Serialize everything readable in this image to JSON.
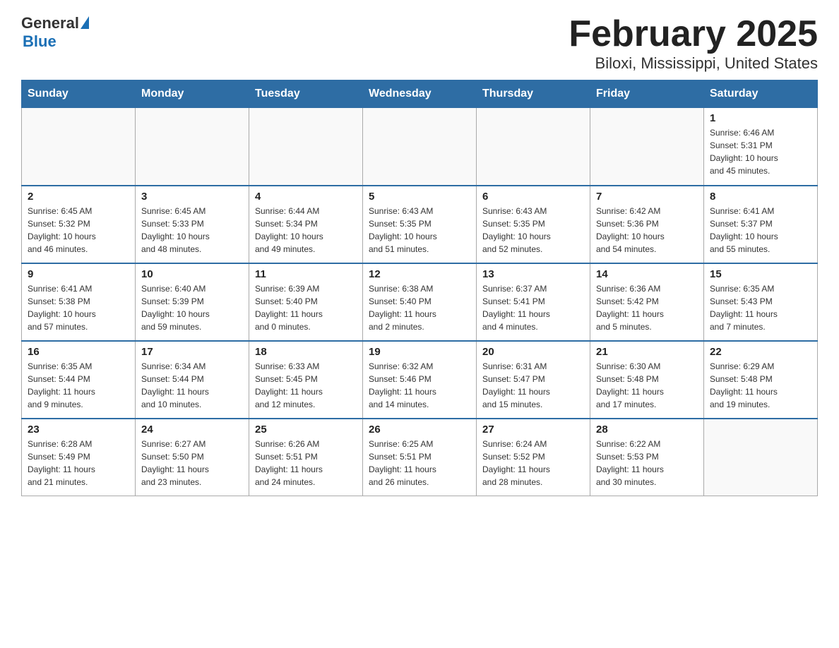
{
  "header": {
    "logo_general": "General",
    "logo_blue": "Blue",
    "title": "February 2025",
    "subtitle": "Biloxi, Mississippi, United States"
  },
  "weekdays": [
    "Sunday",
    "Monday",
    "Tuesday",
    "Wednesday",
    "Thursday",
    "Friday",
    "Saturday"
  ],
  "weeks": [
    [
      {
        "day": "",
        "info": ""
      },
      {
        "day": "",
        "info": ""
      },
      {
        "day": "",
        "info": ""
      },
      {
        "day": "",
        "info": ""
      },
      {
        "day": "",
        "info": ""
      },
      {
        "day": "",
        "info": ""
      },
      {
        "day": "1",
        "info": "Sunrise: 6:46 AM\nSunset: 5:31 PM\nDaylight: 10 hours\nand 45 minutes."
      }
    ],
    [
      {
        "day": "2",
        "info": "Sunrise: 6:45 AM\nSunset: 5:32 PM\nDaylight: 10 hours\nand 46 minutes."
      },
      {
        "day": "3",
        "info": "Sunrise: 6:45 AM\nSunset: 5:33 PM\nDaylight: 10 hours\nand 48 minutes."
      },
      {
        "day": "4",
        "info": "Sunrise: 6:44 AM\nSunset: 5:34 PM\nDaylight: 10 hours\nand 49 minutes."
      },
      {
        "day": "5",
        "info": "Sunrise: 6:43 AM\nSunset: 5:35 PM\nDaylight: 10 hours\nand 51 minutes."
      },
      {
        "day": "6",
        "info": "Sunrise: 6:43 AM\nSunset: 5:35 PM\nDaylight: 10 hours\nand 52 minutes."
      },
      {
        "day": "7",
        "info": "Sunrise: 6:42 AM\nSunset: 5:36 PM\nDaylight: 10 hours\nand 54 minutes."
      },
      {
        "day": "8",
        "info": "Sunrise: 6:41 AM\nSunset: 5:37 PM\nDaylight: 10 hours\nand 55 minutes."
      }
    ],
    [
      {
        "day": "9",
        "info": "Sunrise: 6:41 AM\nSunset: 5:38 PM\nDaylight: 10 hours\nand 57 minutes."
      },
      {
        "day": "10",
        "info": "Sunrise: 6:40 AM\nSunset: 5:39 PM\nDaylight: 10 hours\nand 59 minutes."
      },
      {
        "day": "11",
        "info": "Sunrise: 6:39 AM\nSunset: 5:40 PM\nDaylight: 11 hours\nand 0 minutes."
      },
      {
        "day": "12",
        "info": "Sunrise: 6:38 AM\nSunset: 5:40 PM\nDaylight: 11 hours\nand 2 minutes."
      },
      {
        "day": "13",
        "info": "Sunrise: 6:37 AM\nSunset: 5:41 PM\nDaylight: 11 hours\nand 4 minutes."
      },
      {
        "day": "14",
        "info": "Sunrise: 6:36 AM\nSunset: 5:42 PM\nDaylight: 11 hours\nand 5 minutes."
      },
      {
        "day": "15",
        "info": "Sunrise: 6:35 AM\nSunset: 5:43 PM\nDaylight: 11 hours\nand 7 minutes."
      }
    ],
    [
      {
        "day": "16",
        "info": "Sunrise: 6:35 AM\nSunset: 5:44 PM\nDaylight: 11 hours\nand 9 minutes."
      },
      {
        "day": "17",
        "info": "Sunrise: 6:34 AM\nSunset: 5:44 PM\nDaylight: 11 hours\nand 10 minutes."
      },
      {
        "day": "18",
        "info": "Sunrise: 6:33 AM\nSunset: 5:45 PM\nDaylight: 11 hours\nand 12 minutes."
      },
      {
        "day": "19",
        "info": "Sunrise: 6:32 AM\nSunset: 5:46 PM\nDaylight: 11 hours\nand 14 minutes."
      },
      {
        "day": "20",
        "info": "Sunrise: 6:31 AM\nSunset: 5:47 PM\nDaylight: 11 hours\nand 15 minutes."
      },
      {
        "day": "21",
        "info": "Sunrise: 6:30 AM\nSunset: 5:48 PM\nDaylight: 11 hours\nand 17 minutes."
      },
      {
        "day": "22",
        "info": "Sunrise: 6:29 AM\nSunset: 5:48 PM\nDaylight: 11 hours\nand 19 minutes."
      }
    ],
    [
      {
        "day": "23",
        "info": "Sunrise: 6:28 AM\nSunset: 5:49 PM\nDaylight: 11 hours\nand 21 minutes."
      },
      {
        "day": "24",
        "info": "Sunrise: 6:27 AM\nSunset: 5:50 PM\nDaylight: 11 hours\nand 23 minutes."
      },
      {
        "day": "25",
        "info": "Sunrise: 6:26 AM\nSunset: 5:51 PM\nDaylight: 11 hours\nand 24 minutes."
      },
      {
        "day": "26",
        "info": "Sunrise: 6:25 AM\nSunset: 5:51 PM\nDaylight: 11 hours\nand 26 minutes."
      },
      {
        "day": "27",
        "info": "Sunrise: 6:24 AM\nSunset: 5:52 PM\nDaylight: 11 hours\nand 28 minutes."
      },
      {
        "day": "28",
        "info": "Sunrise: 6:22 AM\nSunset: 5:53 PM\nDaylight: 11 hours\nand 30 minutes."
      },
      {
        "day": "",
        "info": ""
      }
    ]
  ]
}
